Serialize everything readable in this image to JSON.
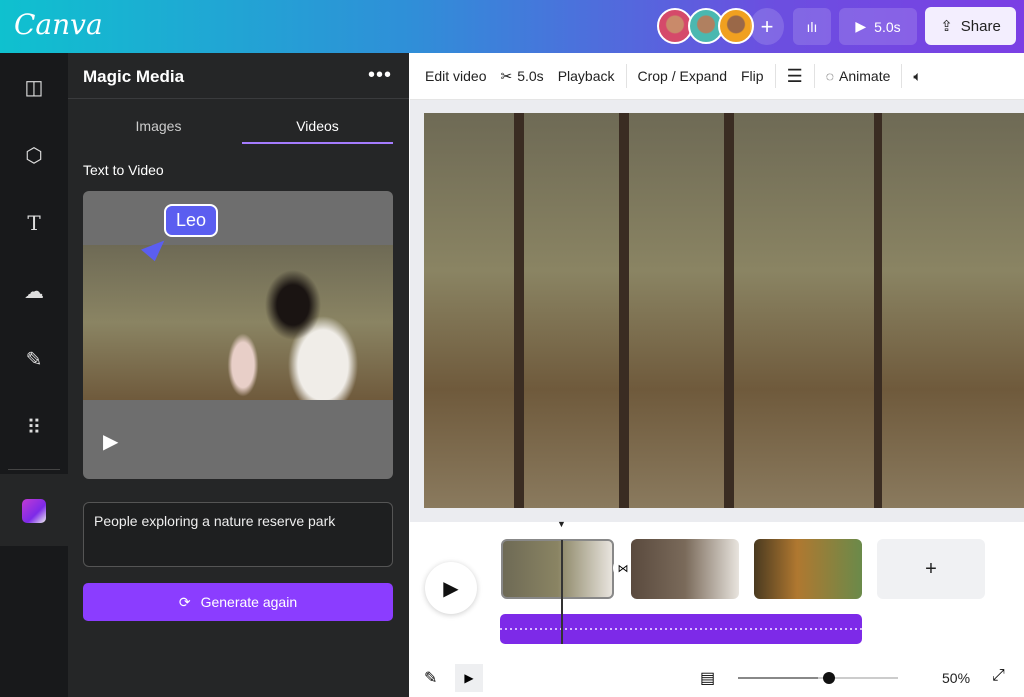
{
  "header": {
    "logo": "Canva",
    "play_duration": "5.0s",
    "share_label": "Share",
    "icons": [
      "avatar-1",
      "avatar-2",
      "avatar-3",
      "plus-icon",
      "chart-icon",
      "play-icon",
      "share-icon"
    ]
  },
  "rail": {
    "icons": [
      "layout-icon",
      "elements-icon",
      "text-icon",
      "upload-icon",
      "draw-icon",
      "apps-icon",
      "magic-media-icon"
    ]
  },
  "panel": {
    "title": "Magic Media",
    "tabs": [
      {
        "label": "Images",
        "active": false
      },
      {
        "label": "Videos",
        "active": true
      }
    ],
    "section": "Text to Video",
    "cursor_label": "Leo",
    "prompt": "People exploring a nature reserve park",
    "generate_label": "Generate again"
  },
  "toolbar": {
    "edit_video": "Edit video",
    "duration": "5.0s",
    "playback": "Playback",
    "crop": "Crop / Expand",
    "flip": "Flip",
    "animate": "Animate"
  },
  "timeline": {
    "zoom_label": "50%",
    "zoom_level": 0.5,
    "add_label": "+"
  },
  "colors": {
    "accent": "#8b3dff",
    "audio": "#7d2ae8"
  }
}
